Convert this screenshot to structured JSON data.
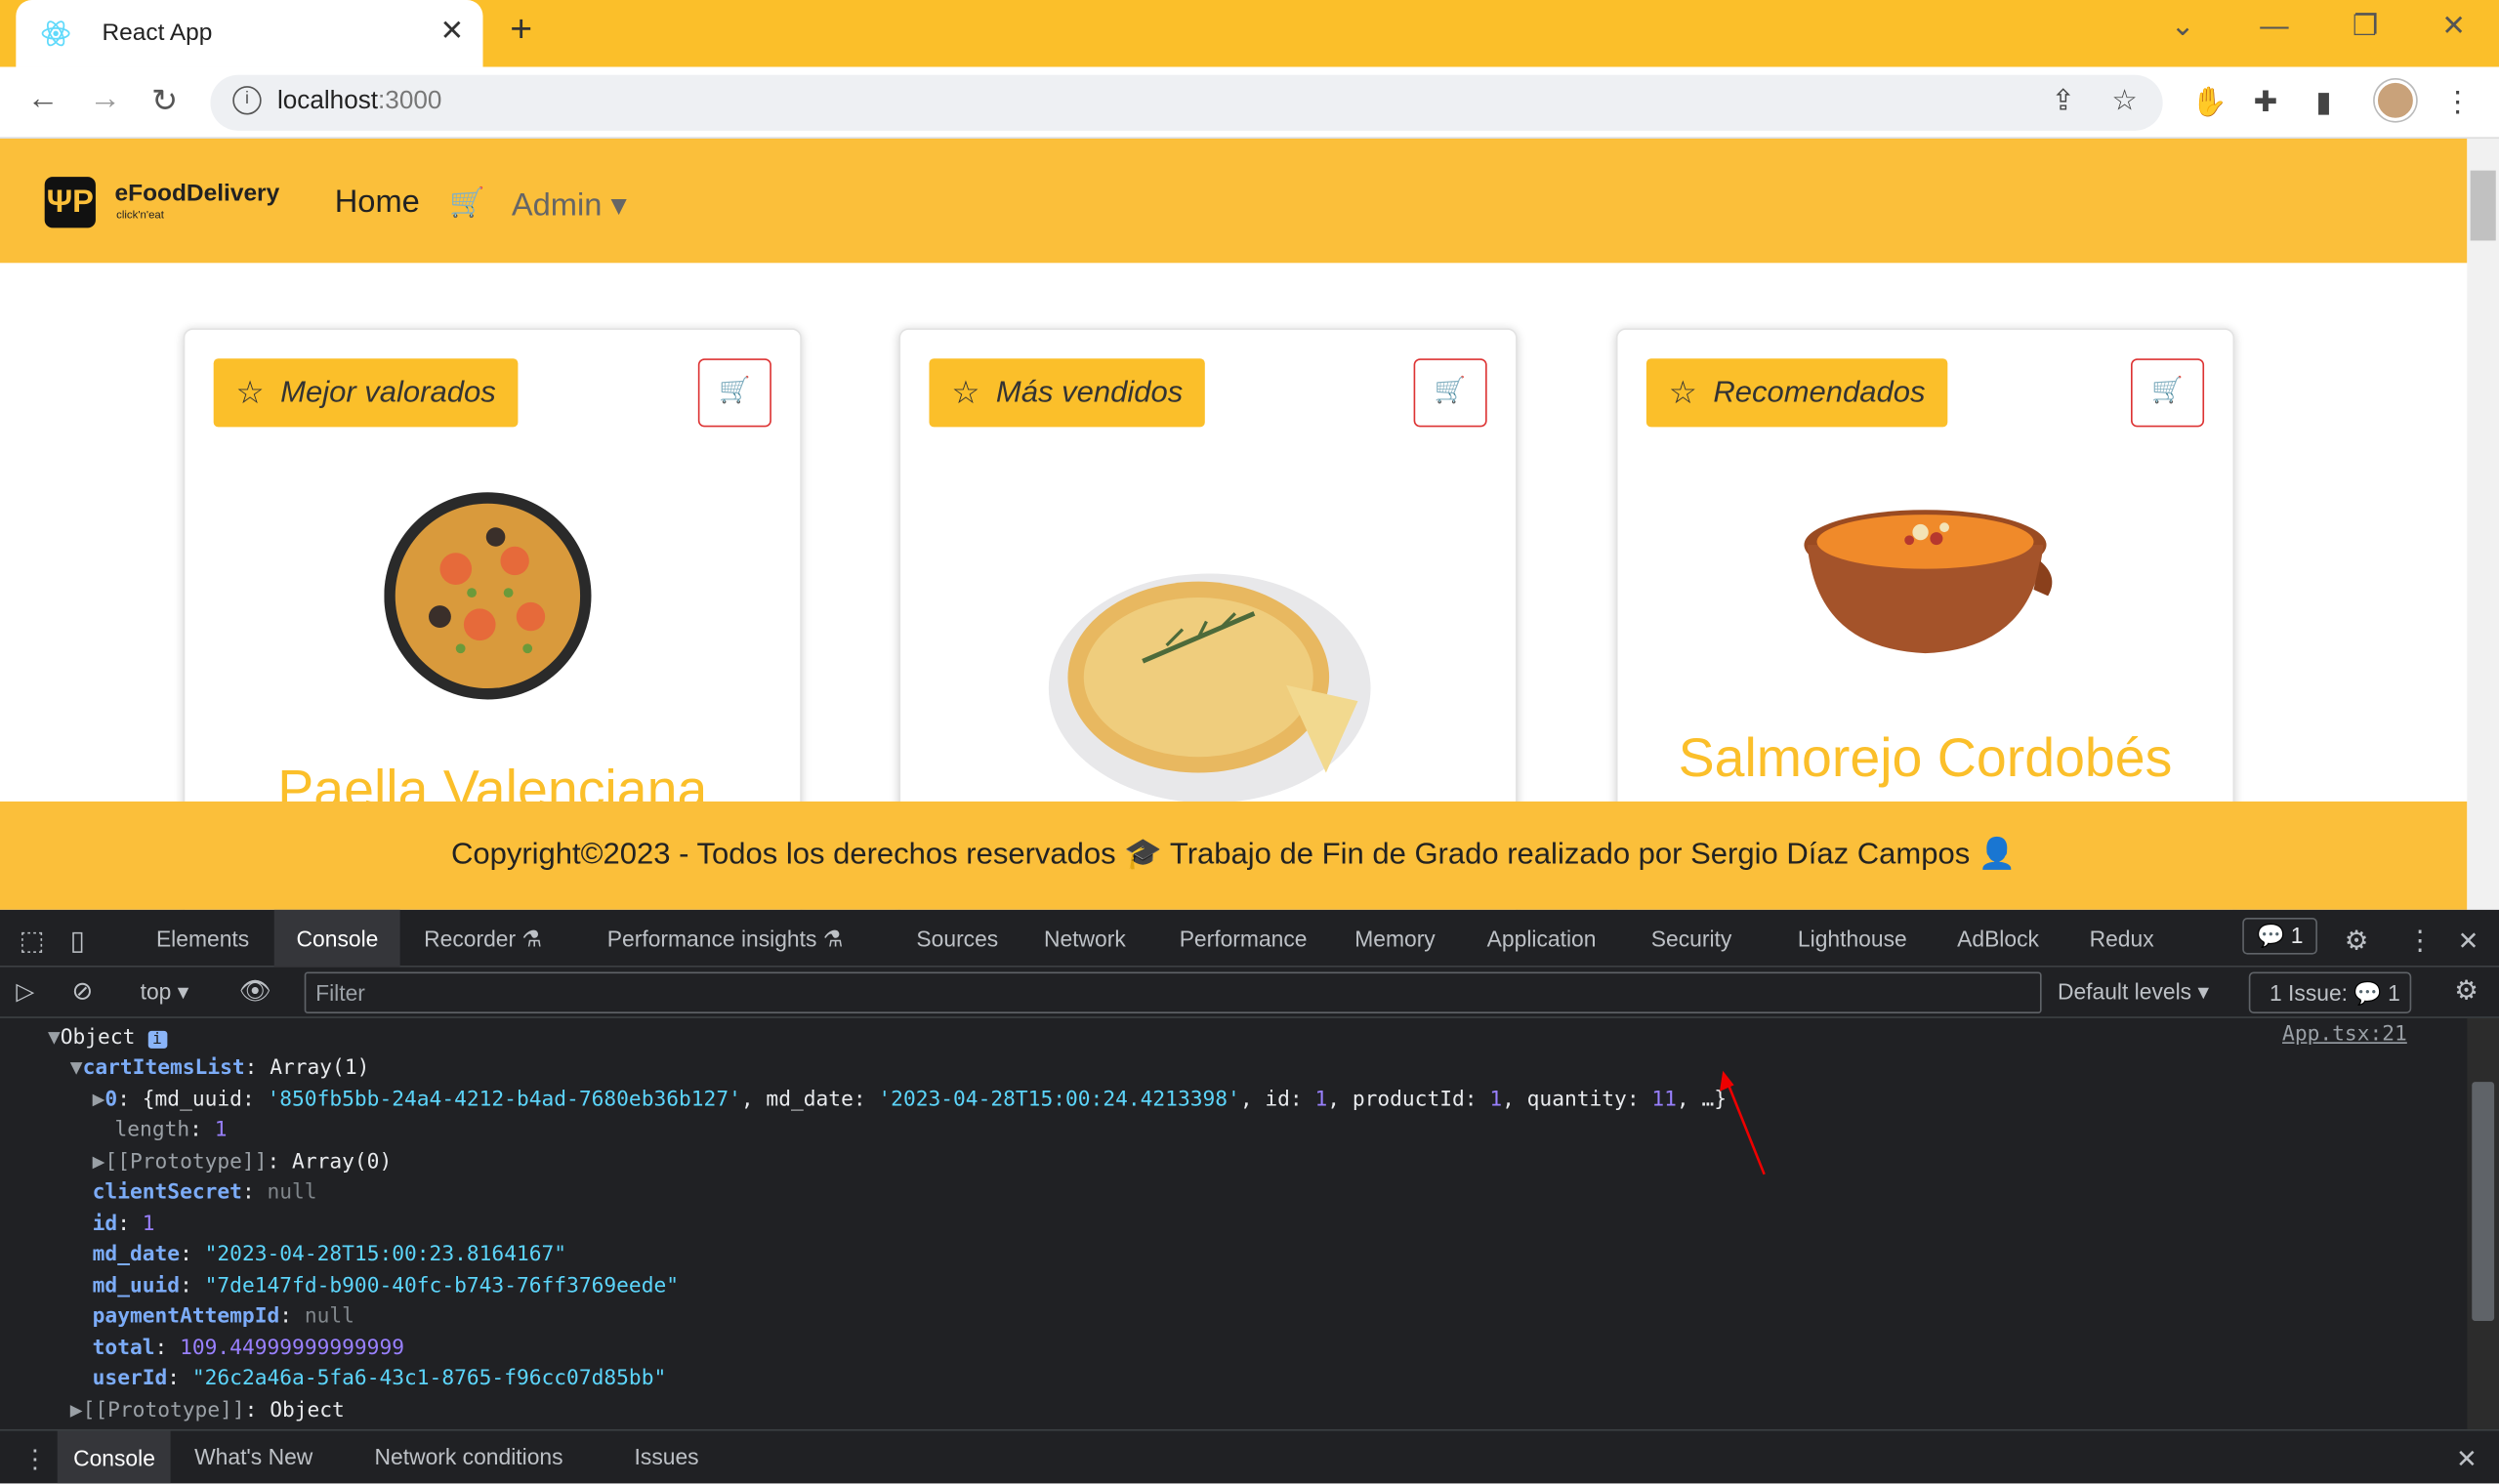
{
  "browser": {
    "tab_title": "React App",
    "url_host": "localhost",
    "url_port": ":3000"
  },
  "app": {
    "brand": "eFoodDelivery",
    "brand_sub": "click'n'eat",
    "nav_home": "Home",
    "nav_admin": "Admin",
    "cards": [
      {
        "badge": "Mejor valorados",
        "dish": "Paella Valenciana"
      },
      {
        "badge": "Más vendidos",
        "dish": ""
      },
      {
        "badge": "Recomendados",
        "dish": "Salmorejo Cordobés"
      }
    ],
    "footer": "Copyright©2023 - Todos los derechos reservados 🎓 Trabajo de Fin de Grado realizado por Sergio Díaz Campos 👤"
  },
  "devtools": {
    "tabs": [
      "Elements",
      "Console",
      "Recorder ⚗",
      "Performance insights ⚗",
      "Sources",
      "Network",
      "Performance",
      "Memory",
      "Application",
      "Security",
      "Lighthouse",
      "AdBlock",
      "Redux"
    ],
    "messages_count": "1",
    "context": "top",
    "filter_placeholder": "Filter",
    "levels": "Default levels",
    "issues": "1 Issue:",
    "issues_count": "1",
    "source_link": "App.tsx:21",
    "drawer_tabs": [
      "Console",
      "What's New",
      "Network conditions",
      "Issues"
    ],
    "log": {
      "root": "Object",
      "cartItemsList_label": "cartItemsList",
      "cartItemsList_val": "Array(1)",
      "item0_uuid": "'850fb5bb-24a4-4212-b4ad-7680eb36b127'",
      "item0_date": "'2023-04-28T15:00:24.4213398'",
      "item0_id": "1",
      "item0_productId": "1",
      "item0_quantity": "11",
      "length": "1",
      "proto_array": "Array(0)",
      "clientSecret": "null",
      "id": "1",
      "md_date": "\"2023-04-28T15:00:23.8164167\"",
      "md_uuid": "\"7de147fd-b900-40fc-b743-76ff3769eede\"",
      "paymentAttempId": "null",
      "total": "109.44999999999999",
      "userId": "\"26c2a46a-5fa6-43c1-8765-f96cc07d85bb\"",
      "proto_object": "Object"
    }
  },
  "colors": {
    "accent_yellow": "#fbbf2a",
    "cart_red": "#dd3333",
    "devtools_bg": "#202124"
  }
}
